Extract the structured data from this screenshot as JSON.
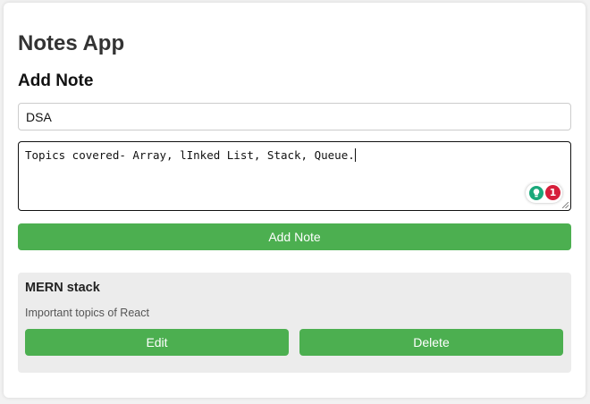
{
  "app": {
    "title": "Notes App"
  },
  "form": {
    "heading": "Add Note",
    "title_value": "DSA",
    "content_value": "Topics covered- Array, lInked List, Stack, Queue.",
    "add_button_label": "Add Note",
    "assistant_issue_count": "1"
  },
  "notes": [
    {
      "title": "MERN stack",
      "content": "Important topics of React",
      "edit_label": "Edit",
      "delete_label": "Delete"
    }
  ],
  "colors": {
    "button_green": "#4caf50",
    "note_card_bg": "#ececec",
    "badge_red": "#d61f3b",
    "bulb_teal": "#1aa87a"
  }
}
